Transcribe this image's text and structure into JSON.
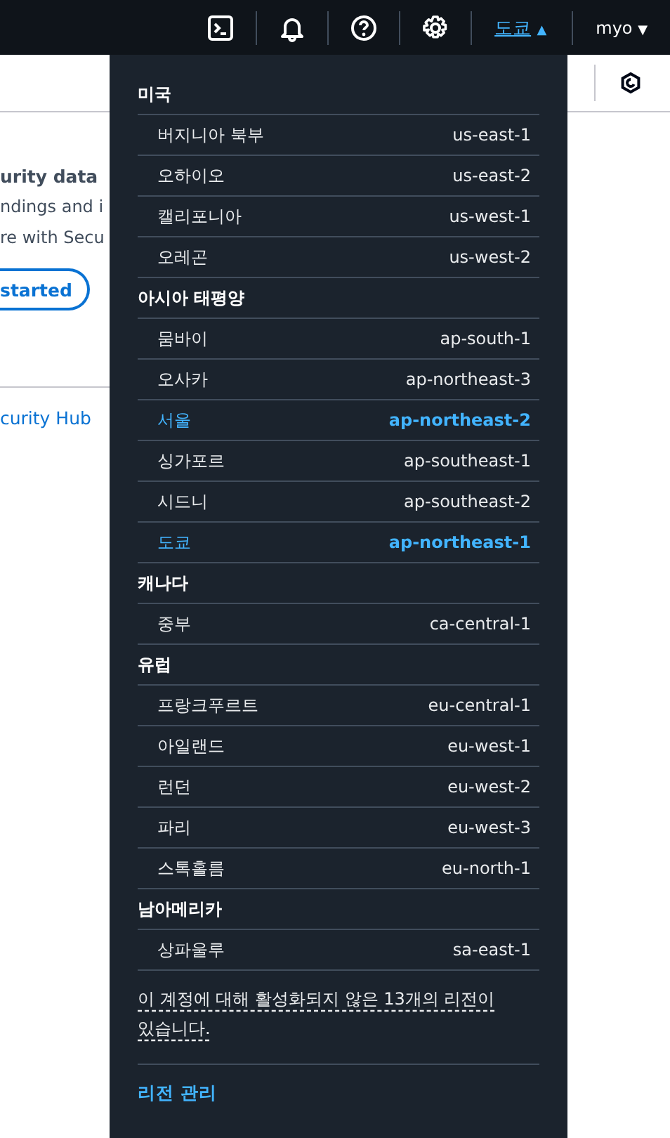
{
  "top_bar": {
    "region": "도쿄",
    "region_caret": "▲",
    "user": "myo",
    "user_caret": "▼"
  },
  "background": {
    "texts": [
      "urity data",
      "ndings and i",
      "re with Secu"
    ],
    "button": "started",
    "link": "curity Hub"
  },
  "region_menu": {
    "groups": [
      {
        "name": "미국",
        "regions": [
          {
            "name": "버지니아 북부",
            "code": "us-east-1",
            "selected": false
          },
          {
            "name": "오하이오",
            "code": "us-east-2",
            "selected": false
          },
          {
            "name": "캘리포니아",
            "code": "us-west-1",
            "selected": false
          },
          {
            "name": "오레곤",
            "code": "us-west-2",
            "selected": false
          }
        ]
      },
      {
        "name": "아시아 태평양",
        "regions": [
          {
            "name": "뭄바이",
            "code": "ap-south-1",
            "selected": false
          },
          {
            "name": "오사카",
            "code": "ap-northeast-3",
            "selected": false
          },
          {
            "name": "서울",
            "code": "ap-northeast-2",
            "selected": true
          },
          {
            "name": "싱가포르",
            "code": "ap-southeast-1",
            "selected": false
          },
          {
            "name": "시드니",
            "code": "ap-southeast-2",
            "selected": false
          },
          {
            "name": "도쿄",
            "code": "ap-northeast-1",
            "selected": true
          }
        ]
      },
      {
        "name": "캐나다",
        "regions": [
          {
            "name": "중부",
            "code": "ca-central-1",
            "selected": false
          }
        ]
      },
      {
        "name": "유럽",
        "regions": [
          {
            "name": "프랑크푸르트",
            "code": "eu-central-1",
            "selected": false
          },
          {
            "name": "아일랜드",
            "code": "eu-west-1",
            "selected": false
          },
          {
            "name": "런던",
            "code": "eu-west-2",
            "selected": false
          },
          {
            "name": "파리",
            "code": "eu-west-3",
            "selected": false
          },
          {
            "name": "스톡홀름",
            "code": "eu-north-1",
            "selected": false
          }
        ]
      },
      {
        "name": "남아메리카",
        "regions": [
          {
            "name": "상파울루",
            "code": "sa-east-1",
            "selected": false
          }
        ]
      }
    ],
    "note": "이 계정에 대해 활성화되지 않은 13개의 리전이 있습니다.",
    "manage_link": "리전 관리"
  }
}
